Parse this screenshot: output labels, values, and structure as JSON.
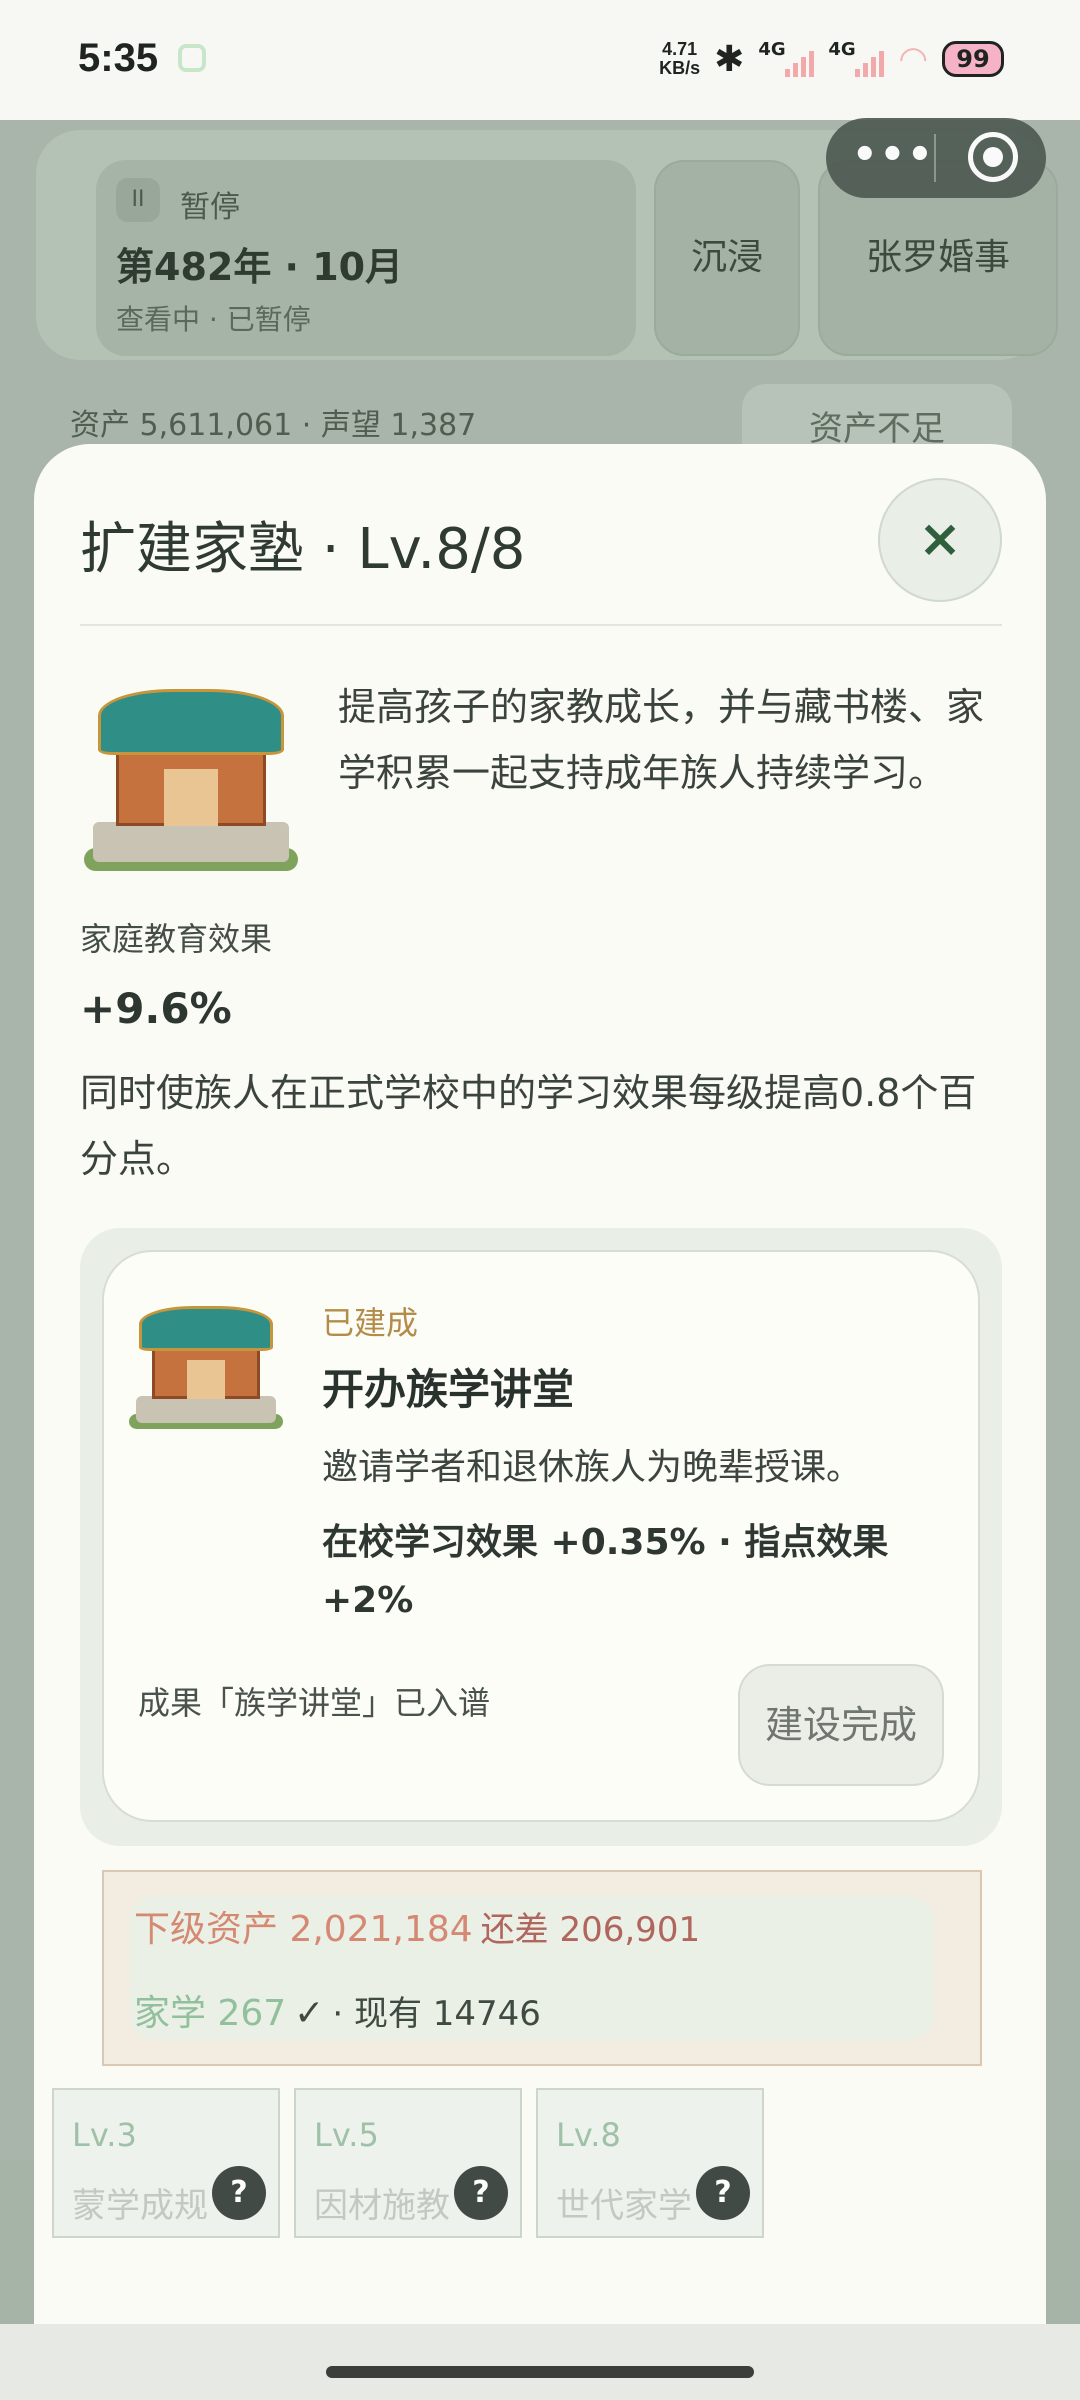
{
  "status_bar": {
    "time": "5:35",
    "speed_value": "4.71",
    "speed_unit": "KB/s",
    "net1": "4G",
    "net2": "4G",
    "battery": "99"
  },
  "background": {
    "pause_label": "暂停",
    "year_month": "第482年 · 10月",
    "view_status": "查看中 · 已暂停",
    "immerse_button": "沉浸",
    "marriage_button": "张罗婚事",
    "assets_line": "资产 5,611,061 · 声望 1,387",
    "insufficient_button": "资产不足"
  },
  "modal": {
    "title": "扩建家塾 · Lv.8/8",
    "close": "×",
    "description": "提高孩子的家教成长，并与藏书楼、家学积累一起支持成年族人持续学习。",
    "effect_label": "家庭教育效果",
    "effect_value": "+9.6%",
    "effect_note": "同时使族人在正式学校中的学习效果每级提高0.8个百分点。",
    "upgrade": {
      "status": "已建成",
      "name": "开办族学讲堂",
      "desc": "邀请学者和退休族人为晚辈授课。",
      "stats": "在校学习效果 +0.35% · 指点效果 +2%",
      "footer": "成果「族学讲堂」已入谱",
      "button": "建设完成"
    },
    "cost": {
      "next_assets_label": "下级资产 2,021,184",
      "shortfall": "还差 206,901",
      "family_learning_label": "家学 267",
      "check": "✓",
      "have": "· 现有 14746"
    },
    "milestones": [
      {
        "level": "Lv.3",
        "name": "蒙学成规",
        "help": "?"
      },
      {
        "level": "Lv.5",
        "name": "因材施教",
        "help": "?"
      },
      {
        "level": "Lv.8",
        "name": "世代家学",
        "help": "?"
      }
    ]
  }
}
